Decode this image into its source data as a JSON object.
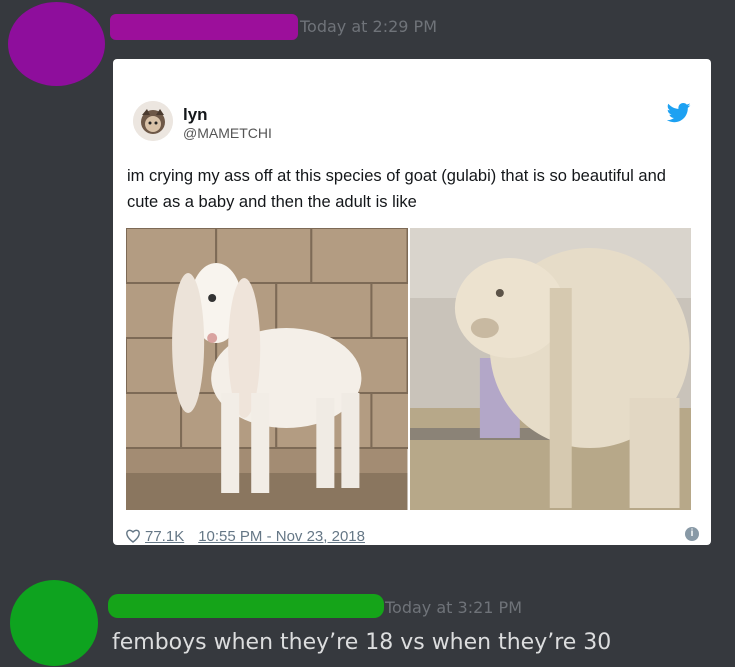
{
  "messages": [
    {
      "timestamp": "Today at 2:29 PM"
    },
    {
      "timestamp": "Today at 3:21 PM",
      "text": "femboys when they’re 18 vs when they’re 30"
    }
  ],
  "tweet": {
    "name": "lyn",
    "handle": "@MAMETCHI",
    "text": "im crying my ass off at this species of goat (gulabi) that is so beautiful and cute as a baby and then the adult is like",
    "likes": "77.1K",
    "date": "10:55 PM - Nov 23, 2018",
    "info": "i",
    "images": [
      "baby-goat-photo",
      "adult-goat-photo"
    ]
  },
  "colors": {
    "background": "#36393e",
    "avatar1": "#8e0e9c",
    "avatar2": "#0ea31f",
    "twitter_blue": "#1da1f2"
  }
}
